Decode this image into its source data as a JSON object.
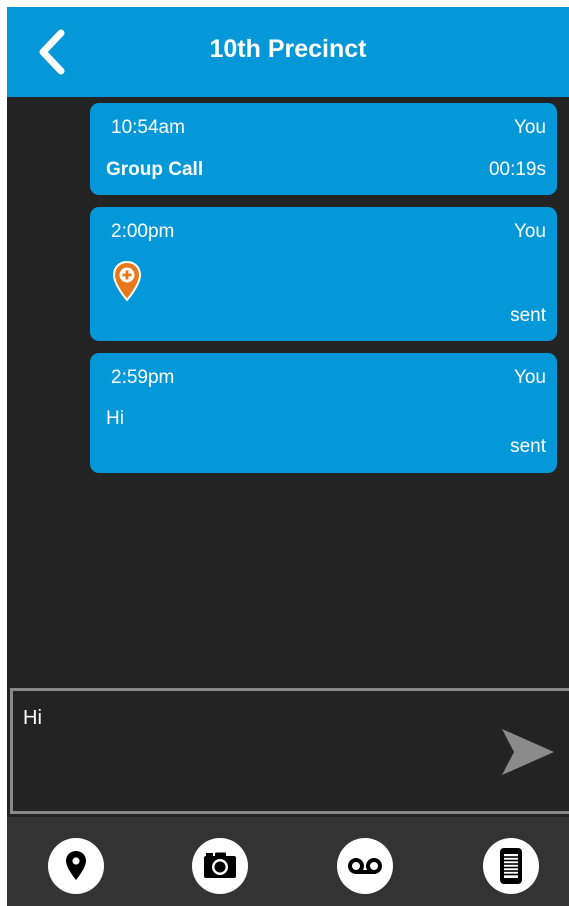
{
  "header": {
    "title": "10th Precinct",
    "back_icon": "chevron-left-icon"
  },
  "messages": [
    {
      "time": "10:54am",
      "sender": "You",
      "body": "Group Call",
      "meta": "00:19s"
    },
    {
      "time": "2:00pm",
      "sender": "You",
      "attachment_icon": "location-pin-icon",
      "status": "sent"
    },
    {
      "time": "2:59pm",
      "sender": "You",
      "body": "Hi",
      "status": "sent"
    }
  ],
  "composer": {
    "value": "Hi",
    "send_icon": "send-arrow-icon"
  },
  "toolbar": {
    "items": [
      {
        "icon": "location-pin-icon"
      },
      {
        "icon": "camera-icon"
      },
      {
        "icon": "voicemail-icon"
      },
      {
        "icon": "document-icon"
      }
    ]
  },
  "colors": {
    "accent": "#0598d8",
    "background": "#232323",
    "toolbar": "#333333",
    "pin": "#e8791a"
  }
}
